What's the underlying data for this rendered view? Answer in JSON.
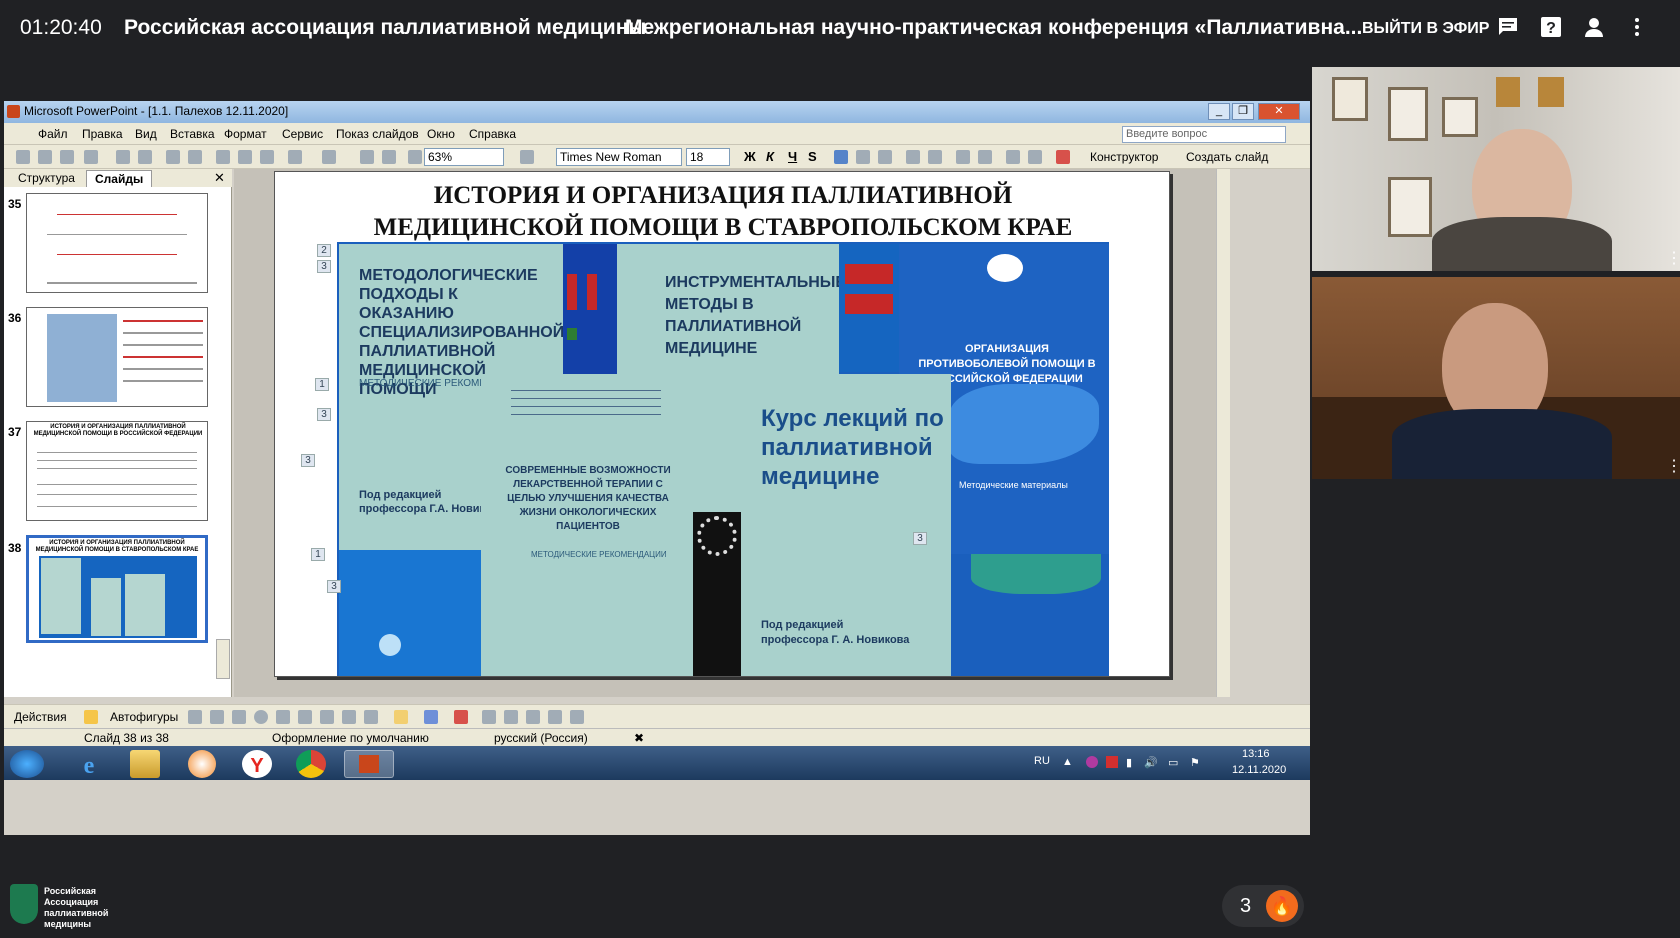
{
  "topbar": {
    "timer": "01:20:40",
    "channel": "Российская ассоциация паллиативной медицины",
    "conference": "Межрегиональная научно-практическая конференция «Паллиативна...",
    "go_live": "ВЫЙТИ В ЭФИР",
    "icons": [
      "chat-icon",
      "help-icon",
      "person-icon",
      "more-vertical-icon"
    ]
  },
  "ppt": {
    "title": "Microsoft PowerPoint - [1.1. Палехов 12.11.2020]",
    "menu": [
      "Файл",
      "Правка",
      "Вид",
      "Вставка",
      "Формат",
      "Сервис",
      "Показ слайдов",
      "Окно",
      "Справка"
    ],
    "ask_placeholder": "Введите вопрос",
    "zoom": "63%",
    "font": "Times New Roman",
    "font_size": "18",
    "fmt_buttons": [
      "Ж",
      "К",
      "Ч",
      "S"
    ],
    "designer": "Конструктор",
    "new_slide": "Создать слайд",
    "tabs": [
      "Структура",
      "Слайды"
    ],
    "thumbs": [
      {
        "num": "35"
      },
      {
        "num": "36"
      },
      {
        "num": "37",
        "title": "ИСТОРИЯ И ОРГАНИЗАЦИЯ ПАЛЛИАТИВНОЙ МЕДИЦИНСКОЙ ПОМОЩИ В РОССИЙСКОЙ ФЕДЕРАЦИИ"
      },
      {
        "num": "38",
        "title": "ИСТОРИЯ И ОРГАНИЗАЦИЯ ПАЛЛИАТИВНОЙ МЕДИЦИНСКОЙ ПОМОЩИ В СТАВРОПОЛЬСКОМ КРАЕ"
      }
    ],
    "slide": {
      "title_line1": "ИСТОРИЯ И ОРГАНИЗАЦИЯ ПАЛЛИАТИВНОЙ",
      "title_line2": "МЕДИЦИНСКОЙ ПОМОЩИ В СТАВРОПОЛЬСКОМ КРАЕ",
      "book1_title": "МЕТОДОЛОГИЧЕСКИЕ ПОДХОДЫ К ОКАЗАНИЮ СПЕЦИАЛИЗИРОВАННОЙ ПАЛЛИАТИВНОЙ МЕДИЦИНСКОЙ ПОМОЩИ",
      "book1_sub": "МЕТОДИЧЕСКИЕ РЕКОМЕН",
      "book1_editor": "Под редакцией профессора Г.А. Новик",
      "book2_title": "ИНСТРУМЕНТАЛЬНЫЕ МЕТОДЫ В ПАЛЛИАТИВНОЙ МЕДИЦИНЕ",
      "book3_title": "ОРГАНИЗАЦИЯ ПРОТИВОБОЛЕВОЙ ПОМОЩИ В РОССИЙСКОЙ ФЕДЕРАЦИИ",
      "book3_sub": "Методические материалы",
      "book4_title": "СОВРЕМЕННЫЕ ВОЗМОЖНОСТИ ЛЕКАРСТВЕННОЙ ТЕРАПИИ С ЦЕЛЬЮ УЛУЧШЕНИЯ КАЧЕСТВА ЖИЗНИ ОНКОЛОГИЧЕСКИХ ПАЦИЕНТОВ",
      "book4_sub": "МЕТОДИЧЕСКИЕ РЕКОМЕНДАЦИИ",
      "book5_title": "Курс лекций по паллиативной медицине",
      "book5_editor": "Под редакцией профессора Г. А. Новикова",
      "badges": [
        "2",
        "3",
        "1",
        "3",
        "3",
        "1",
        "3",
        "3"
      ]
    },
    "draw_actions": "Действия",
    "autoshapes": "Автофигуры",
    "status": {
      "slide": "Слайд 38 из 38",
      "design": "Оформление по умолчанию",
      "lang": "русский (Россия)"
    }
  },
  "taskbar": {
    "lang": "RU",
    "time": "13:16",
    "date": "12.11.2020"
  },
  "bottom": {
    "org": "Российская Ассоциация паллиативной медицины",
    "reaction_count": "3"
  }
}
